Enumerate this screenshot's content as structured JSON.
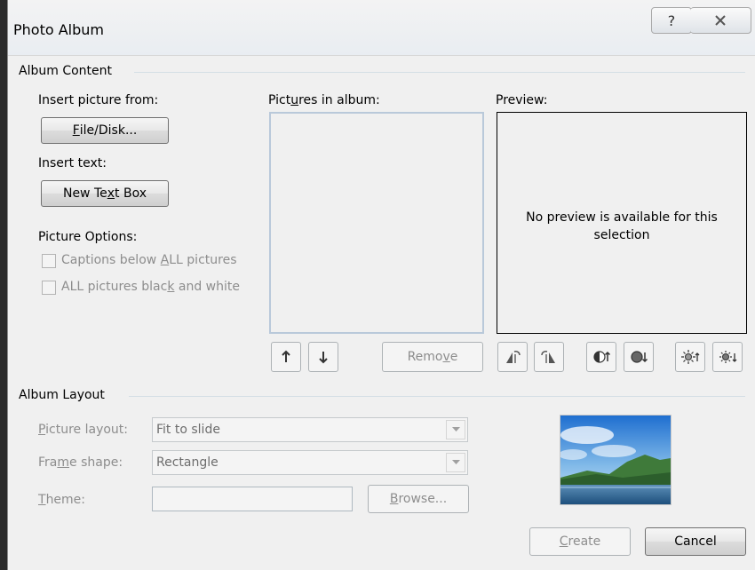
{
  "window": {
    "title": "Photo Album",
    "help_glyph": "?",
    "close_glyph": "X"
  },
  "album_content": {
    "legend": "Album Content",
    "insert_picture_label": "Insert picture from:",
    "file_disk_button": {
      "pre": "",
      "key": "F",
      "post": "ile/Disk..."
    },
    "insert_text_label": "Insert text:",
    "new_text_box_button": {
      "pre": "New Te",
      "key": "x",
      "post": "t Box"
    },
    "picture_options_label": "Picture Options:",
    "captions_checkbox": {
      "pre": "Captions below ",
      "key": "A",
      "post": "LL pictures",
      "checked": false,
      "enabled": false
    },
    "bw_checkbox": {
      "pre": "ALL pictures blac",
      "key": "k",
      "post": " and white",
      "checked": false,
      "enabled": false
    },
    "pictures_label": {
      "pre": "Pict",
      "key": "u",
      "post": "res in album:"
    },
    "preview_label": "Preview:",
    "preview_message": "No preview is available for this selection",
    "remove_button": {
      "pre": "Remo",
      "key": "v",
      "post": "e"
    }
  },
  "album_layout": {
    "legend": "Album Layout",
    "picture_layout_label": {
      "pre": "",
      "key": "P",
      "post": "icture layout:"
    },
    "picture_layout_value": "Fit to slide",
    "frame_shape_label": {
      "pre": "Fra",
      "key": "m",
      "post": "e shape:"
    },
    "frame_shape_value": "Rectangle",
    "theme_label": {
      "pre": "",
      "key": "T",
      "post": "heme:"
    },
    "theme_value": "",
    "browse_button": {
      "pre": "",
      "key": "B",
      "post": "rowse..."
    }
  },
  "footer": {
    "create_button": {
      "pre": "",
      "key": "C",
      "post": "reate"
    },
    "cancel_button": "Cancel"
  },
  "colors": {
    "disabled_text": "#8d8d8d",
    "group_line": "#d5dfe5",
    "listbox_border": "#b9c9da"
  }
}
